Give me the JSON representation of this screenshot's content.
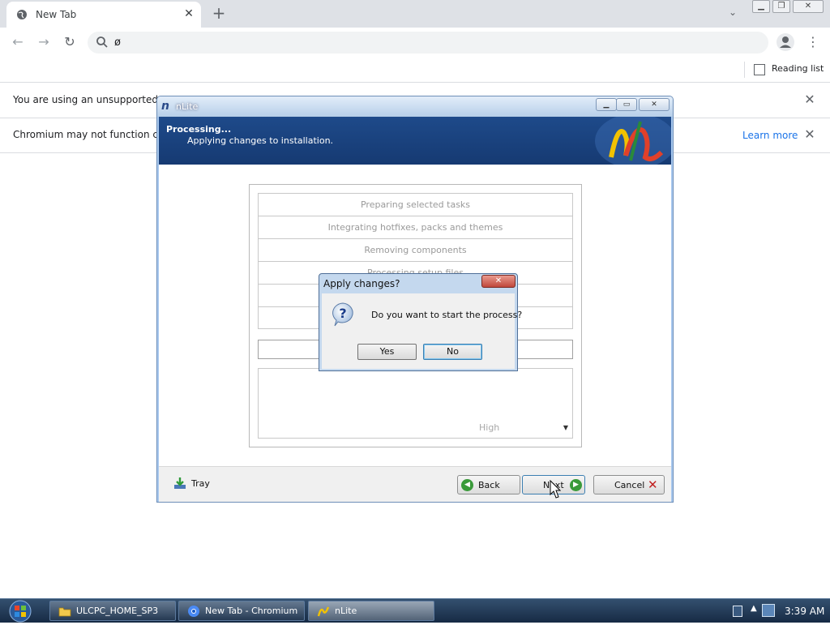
{
  "browser": {
    "tab": {
      "title": "New Tab",
      "favicon": "globe-icon"
    },
    "new_tab_symbol": "+",
    "address_bar": {
      "value": "ø"
    },
    "bookmarks": {
      "reading_list_label": "Reading list"
    },
    "infobars": [
      {
        "message": "You are using an unsupported co"
      },
      {
        "message": "Chromium may not function corre",
        "action_label": "Learn more"
      }
    ]
  },
  "nlite": {
    "window_title": "nLite",
    "header": {
      "title": "Processing...",
      "subtitle": "Applying changes to installation."
    },
    "tasks": [
      "Preparing selected tasks",
      "Integrating hotfixes, packs and themes",
      "Removing components",
      "Processing setup files",
      "",
      ""
    ],
    "priority": {
      "value": "High"
    },
    "footer": {
      "tray_label": "Tray",
      "back_label": "Back",
      "next_label": "Next",
      "cancel_label": "Cancel"
    }
  },
  "dialog": {
    "title": "Apply changes?",
    "message": "Do you want to start the process?",
    "yes_label": "Yes",
    "no_label": "No",
    "icon": "question-icon"
  },
  "taskbar": {
    "buttons": [
      {
        "label": "ULCPC_HOME_SP3",
        "icon": "folder-icon"
      },
      {
        "label": "New Tab - Chromium",
        "icon": "chromium-icon"
      },
      {
        "label": "nLite",
        "icon": "nlite-icon"
      }
    ],
    "clock": "3:39 AM"
  },
  "colors": {
    "nlite_header": "#1e4a8a",
    "link_blue": "#1a73e8",
    "taskbar": "#1f3554"
  }
}
